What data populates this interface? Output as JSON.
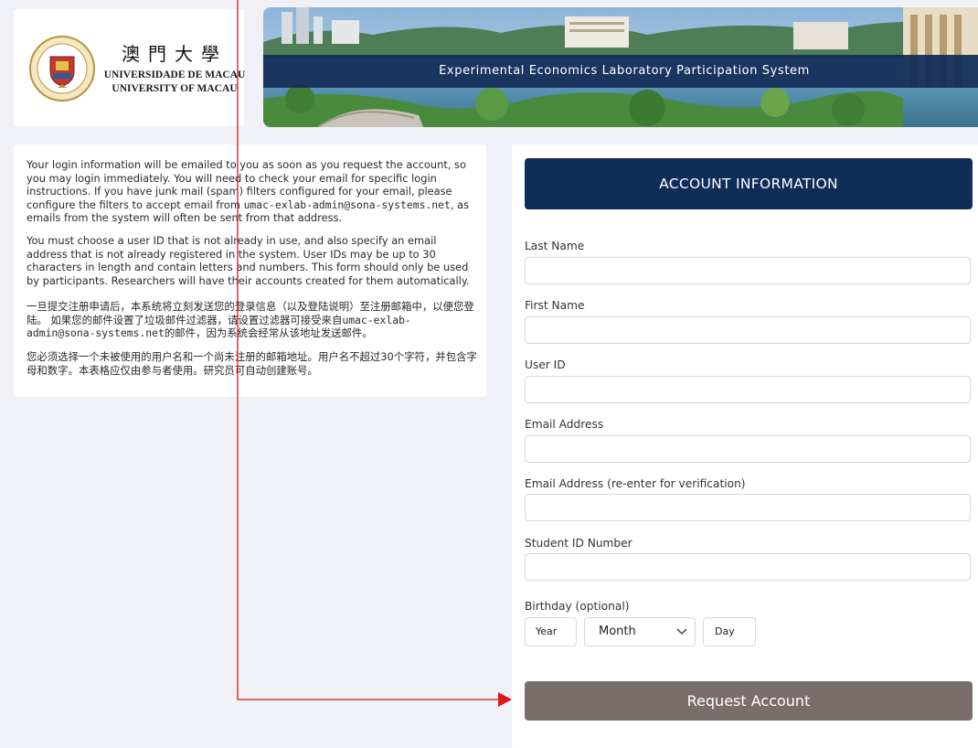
{
  "header": {
    "logo": {
      "chinese": "澳門大學",
      "portuguese": "UNIVERSIDADE DE MACAU",
      "english": "UNIVERSITY OF MACAU"
    },
    "banner_title": "Experimental Economics Laboratory Participation System"
  },
  "info": {
    "p1_a": "Your login information will be emailed to you as soon as you request the account, so you may login immediately. You will need to check your email for specific login instructions. If you have junk mail (spam) filters configured for your email, please configure the filters to accept email from ",
    "p1_email": "umac-exlab-admin@sona-systems.net",
    "p1_b": ", as emails from the system will often be sent from that address.",
    "p2": "You must choose a user ID that is not already in use, and also specify an email address that is not already registered in the system. User IDs may be up to 30 characters in length and contain letters and numbers. This form should only be used by participants. Researchers will have their accounts created for them automatically.",
    "p3_a": "一旦提交注册申请后，本系统将立刻发送您的登录信息（以及登陆说明）至注册邮箱中，以便您登陆。 如果您的邮件设置了垃圾邮件过滤器，请设置过滤器可接受来自",
    "p3_email": "umac-exlab-admin@sona-systems.net",
    "p3_b": "的邮件，因为系统会经常从该地址发送邮件。",
    "p4": "您必须选择一个未被使用的用户名和一个尚未注册的邮箱地址。用户名不超过30个字符，并包含字母和数字。本表格应仅由参与者使用。研究员可自动创建账号。"
  },
  "form": {
    "title": "ACCOUNT INFORMATION",
    "fields": [
      {
        "label": "Last Name",
        "value": ""
      },
      {
        "label": "First Name",
        "value": ""
      },
      {
        "label": "User ID",
        "value": ""
      },
      {
        "label": "Email Address",
        "value": ""
      },
      {
        "label": "Email Address (re-enter for verification)",
        "value": ""
      },
      {
        "label": "Student ID Number",
        "value": ""
      }
    ],
    "birthday": {
      "label": "Birthday (optional)",
      "year": "Year",
      "month": "Month",
      "day": "Day"
    },
    "submit_label": "Request Account"
  },
  "colors": {
    "navy": "#0f2d57",
    "button": "#7a6e6d",
    "annotation_arrow": "#e0141e"
  },
  "icons": [
    "university-seal-icon",
    "chevron-down-icon"
  ]
}
